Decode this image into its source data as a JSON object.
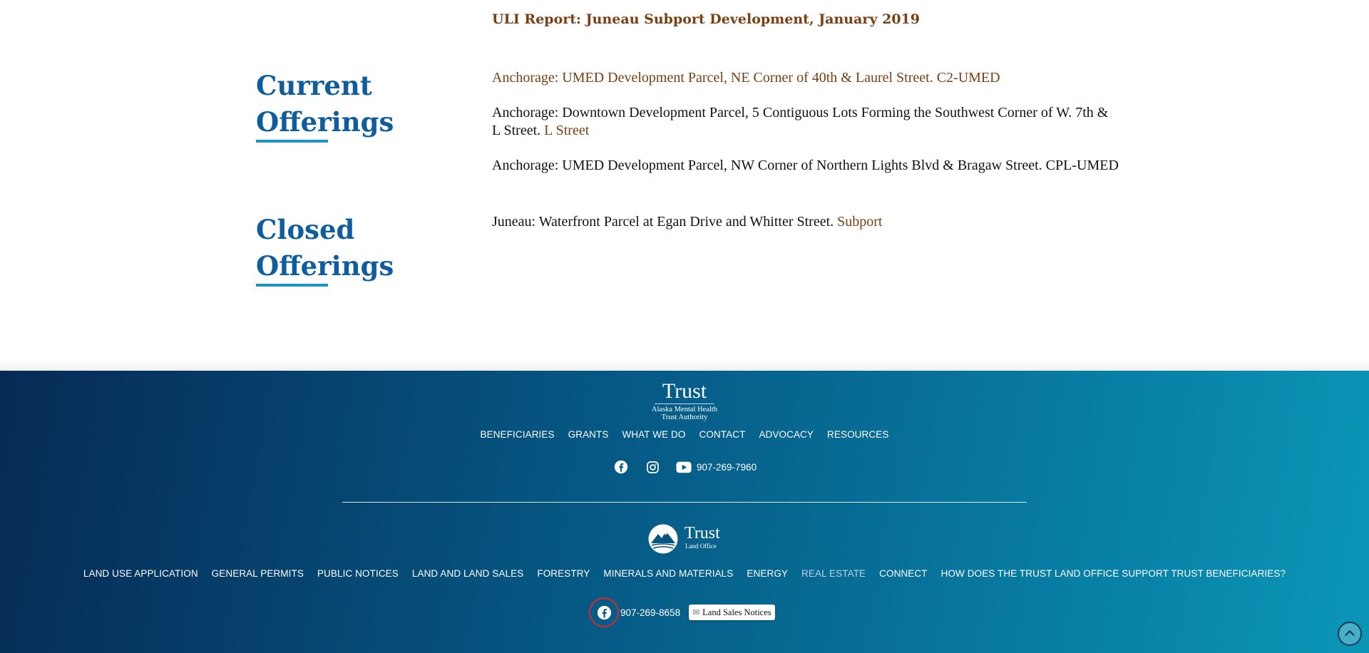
{
  "main": {
    "top_link": "ULI Report: Juneau Subport Development, January 2019",
    "current": {
      "heading_line1": "Current",
      "heading_line2": "Offerings",
      "items": [
        {
          "link": "Anchorage: UMED Development Parcel, NE Corner of 40th & Laurel Street. C2-UMED"
        },
        {
          "text": "Anchorage: Downtown Development Parcel, 5 Contiguous Lots Forming the Southwest Corner of W. 7th & L Street. ",
          "link": "L Street"
        },
        {
          "text": "Anchorage: UMED Development Parcel, NW Corner of Northern Lights Blvd & Bragaw Street. CPL-UMED"
        }
      ]
    },
    "closed": {
      "heading_line1": "Closed",
      "heading_line2": "Offerings",
      "items": [
        {
          "text": "Juneau: Waterfront Parcel at Egan Drive and Whitter Street. ",
          "link": "Subport"
        }
      ]
    }
  },
  "footer": {
    "trust_logo": {
      "word": "Trust",
      "sub1": "Alaska Mental Health",
      "sub2": "Trust Authority"
    },
    "nav_top": [
      "BENEFICIARIES",
      "GRANTS",
      "WHAT WE DO",
      "CONTACT",
      "ADVOCACY",
      "RESOURCES"
    ],
    "phone_trust": "907-269-7960",
    "land_office_logo": {
      "word": "Trust",
      "sub": "Land Office"
    },
    "nav_bottom": [
      "LAND USE APPLICATION",
      "GENERAL PERMITS",
      "PUBLIC NOTICES",
      "LAND AND LAND SALES",
      "FORESTRY",
      "MINERALS AND MATERIALS",
      "ENERGY",
      "REAL ESTATE",
      "CONNECT",
      "HOW DOES THE TRUST LAND OFFICE SUPPORT TRUST BENEFICIARIES?"
    ],
    "nav_bottom_active": "REAL ESTATE",
    "phone_land_office": "907-269-8658",
    "notices_button": "Land Sales Notices"
  },
  "icons": [
    "facebook-icon",
    "instagram-icon",
    "youtube-icon",
    "envelope-icon",
    "scroll-top-icon"
  ],
  "colors": {
    "heading": "#0f5d9c",
    "link": "#7a3f12",
    "underline": "#1a97c0",
    "footer_dark": "#062a55",
    "footer_light": "#0a96b7",
    "highlight_ring": "#d8282f"
  }
}
